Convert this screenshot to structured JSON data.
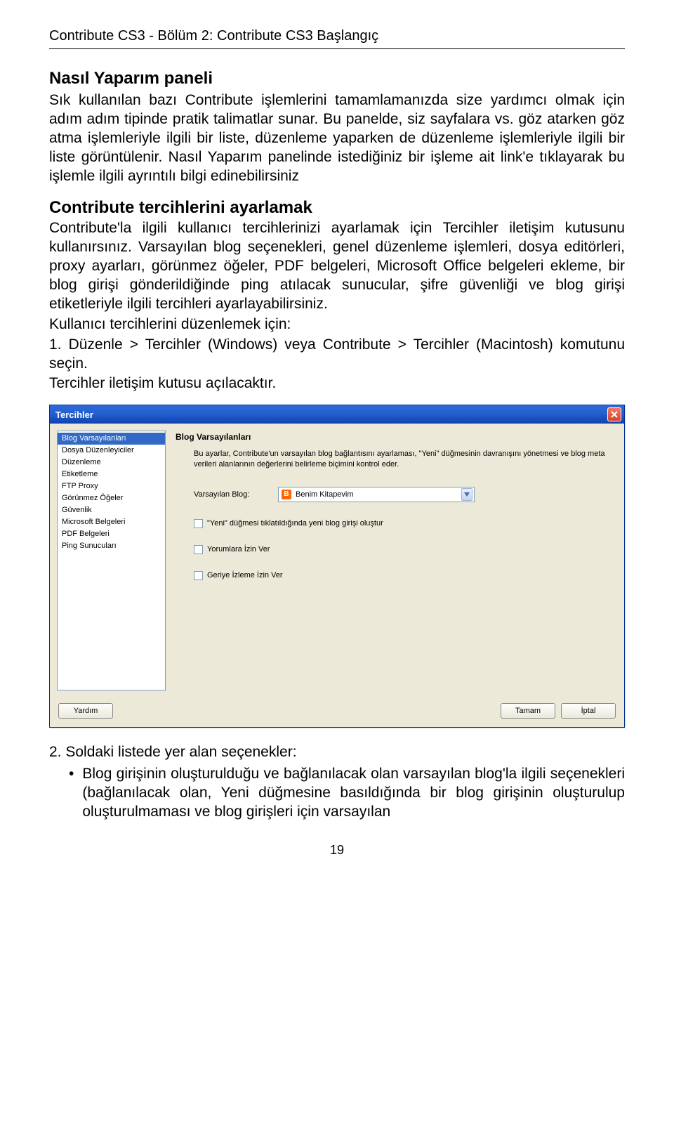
{
  "header": "Contribute CS3 - Bölüm 2: Contribute CS3 Başlangıç",
  "section1": {
    "title": "Nasıl Yaparım paneli",
    "body": "Sık kullanılan bazı Contribute işlemlerini tamamlamanızda size yardımcı olmak için adım adım tipinde pratik talimatlar sunar. Bu panelde, siz sayfalara vs. göz atarken göz atma işlemleriyle ilgili bir liste, düzenleme yaparken de düzenleme işlemleriyle ilgili bir liste görüntülenir. Nasıl Yaparım panelinde istediğiniz bir işleme ait link'e tıklayarak bu işlemle ilgili ayrıntılı bilgi edinebilirsiniz"
  },
  "section2": {
    "title": "Contribute tercihlerini ayarlamak",
    "body": "Contribute'la ilgili kullanıcı tercihlerinizi ayarlamak için Tercihler iletişim kutusunu kullanırsınız. Varsayılan blog seçenekleri, genel düzenleme işlemleri, dosya editörleri, proxy ayarları, görünmez öğeler, PDF belgeleri, Microsoft Office belgeleri ekleme, bir blog girişi gönderildiğinde ping atılacak sunucular, şifre güvenliği ve blog girişi etiketleriyle ilgili tercihleri ayarlayabilirsiniz.",
    "sub1": "Kullanıcı tercihlerini düzenlemek için:",
    "sub2": "1. Düzenle > Tercihler (Windows) veya Contribute > Tercihler (Macintosh) komutunu seçin.",
    "sub3": "Tercihler iletişim kutusu açılacaktır."
  },
  "dialog": {
    "title": "Tercihler",
    "list": [
      "Blog Varsayılanları",
      "Dosya Düzenleyiciler",
      "Düzenleme",
      "Etiketleme",
      "FTP Proxy",
      "Görünmez Öğeler",
      "Güvenlik",
      "Microsoft Belgeleri",
      "PDF Belgeleri",
      "Ping Sunucuları"
    ],
    "pane_title": "Blog Varsayılanları",
    "pane_desc": "Bu ayarlar, Contribute'un varsayılan blog bağlantısını ayarlaması, \"Yeni\" düğmesinin davranışını yönetmesi ve blog meta verileri alanlarının değerlerini belirleme biçimini kontrol eder.",
    "field_label": "Varsayılan Blog:",
    "field_value": "Benim Kitapevim",
    "check1": "\"Yeni\" düğmesi tıklatıldığında yeni blog girişi oluştur",
    "check2": "Yorumlara İzin Ver",
    "check3": "Geriye İzleme İzin Ver",
    "btn_help": "Yardım",
    "btn_ok": "Tamam",
    "btn_cancel": "İptal"
  },
  "after": {
    "line1": "2. Soldaki listede yer alan seçenekler:",
    "bullet1": "Blog girişinin oluşturulduğu ve bağlanılacak olan varsayılan blog'la ilgili seçenekleri (bağlanılacak olan, Yeni düğmesine basıldığında bir blog girişinin oluşturulup oluşturulmaması ve blog girişleri için varsayılan"
  },
  "page_num": "19"
}
